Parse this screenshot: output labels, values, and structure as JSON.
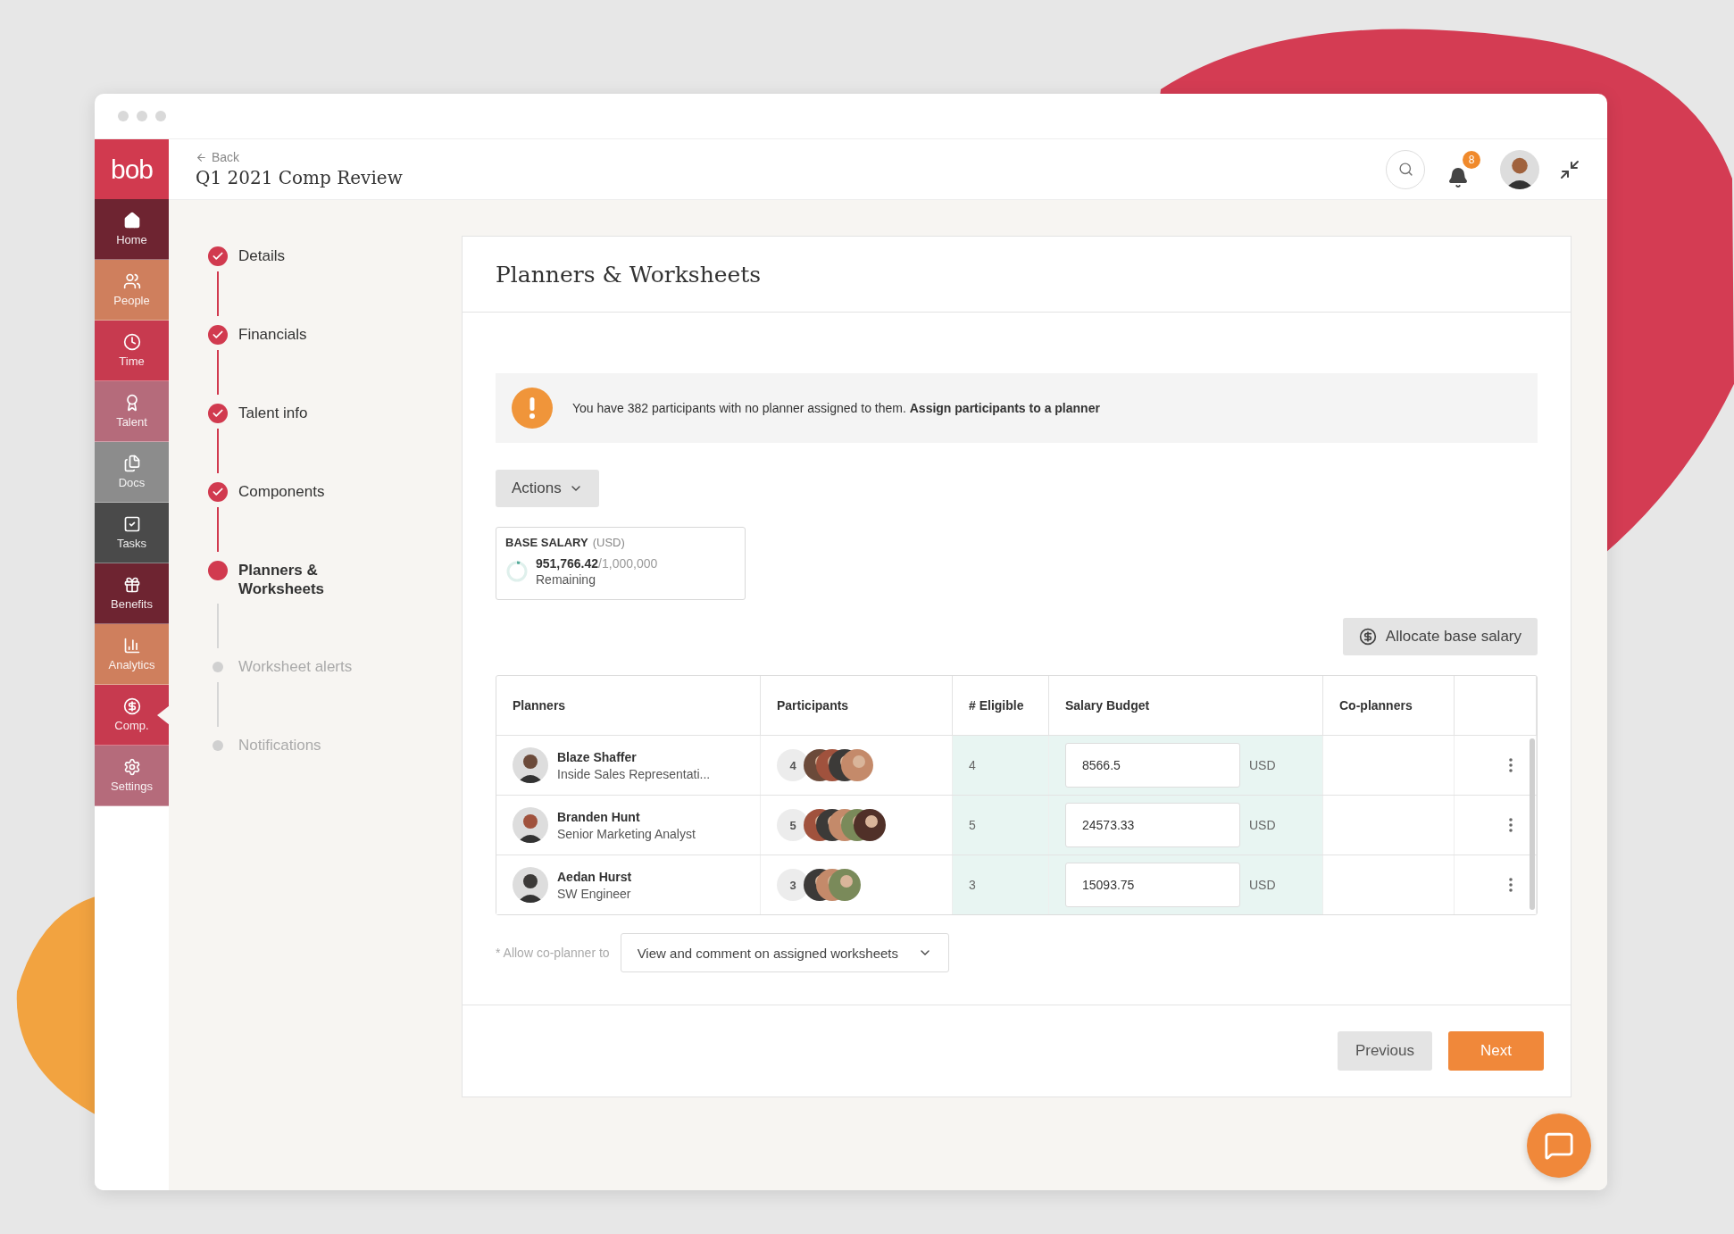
{
  "sidebar": {
    "logo": "bob",
    "items": [
      {
        "label": "Home",
        "color": "#6e2431",
        "selected": false
      },
      {
        "label": "People",
        "color": "#cf7f5d",
        "selected": false
      },
      {
        "label": "Time",
        "color": "#c73a4f",
        "selected": false
      },
      {
        "label": "Talent",
        "color": "#b56b7b",
        "selected": false
      },
      {
        "label": "Docs",
        "color": "#8c8c8c",
        "selected": false
      },
      {
        "label": "Tasks",
        "color": "#4a4a4a",
        "selected": false
      },
      {
        "label": "Benefits",
        "color": "#6e2431",
        "selected": false
      },
      {
        "label": "Analytics",
        "color": "#cf7f5d",
        "selected": false
      },
      {
        "label": "Comp.",
        "color": "#c73a4f",
        "selected": true
      },
      {
        "label": "Settings",
        "color": "#b56b7b",
        "selected": false
      }
    ]
  },
  "header": {
    "back": "Back",
    "title": "Q1 2021 Comp Review",
    "notification_count": "8"
  },
  "steps": [
    {
      "label": "Details",
      "kind": "done"
    },
    {
      "label": "Financials",
      "kind": "done"
    },
    {
      "label": "Talent info",
      "kind": "done"
    },
    {
      "label": "Components",
      "kind": "done"
    },
    {
      "label": "Planners & Worksheets",
      "kind": "current"
    },
    {
      "label": "Worksheet alerts",
      "kind": "upcoming"
    },
    {
      "label": "Notifications",
      "kind": "upcoming"
    }
  ],
  "card": {
    "title": "Planners & Worksheets",
    "banner": "You have 382 participants with no planner assigned to them. **Assign participants to a planner**",
    "actions_button": "Actions",
    "budget": {
      "label": "BASE SALARY",
      "unit": "(USD)",
      "amount": "**951,766.42**/1,000,000",
      "caption": "Remaining",
      "level": 0.05
    },
    "allocate_button": "Allocate base salary",
    "table": {
      "columns": [
        "Planners",
        "Participants",
        "# Eligible",
        "Salary Budget",
        "Co-planners"
      ],
      "rows": [
        {
          "name": "Blaze Shaffer",
          "role": "Inside Sales Representati...",
          "participants": "4",
          "eligible": "4",
          "budget": "8566.5",
          "currency": "USD"
        },
        {
          "name": "Branden Hunt",
          "role": "Senior Marketing Analyst",
          "participants": "5",
          "eligible": "5",
          "budget": "24573.33",
          "currency": "USD"
        },
        {
          "name": "Aedan Hurst",
          "role": "SW Engineer",
          "participants": "3",
          "eligible": "3",
          "budget": "15093.75",
          "currency": "USD"
        }
      ]
    },
    "coplanner": {
      "label": "* Allow co-planner to",
      "value": "View and comment on assigned worksheets"
    },
    "buttons": {
      "previous": "Previous",
      "next": "Next"
    }
  }
}
